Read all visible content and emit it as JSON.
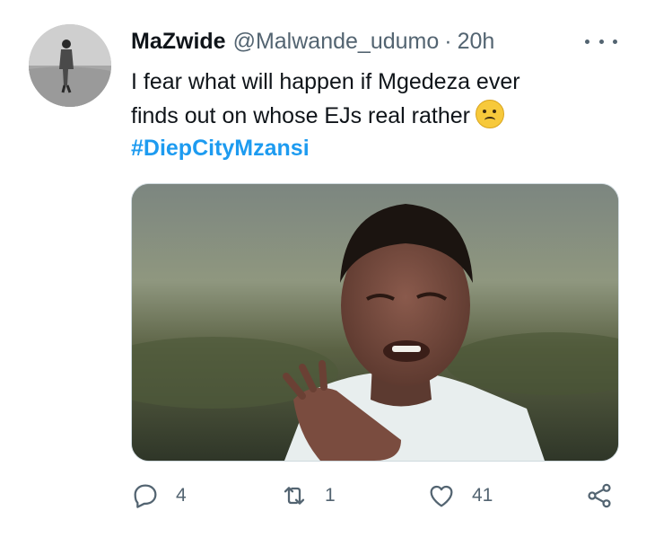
{
  "tweet": {
    "author_name": "MaZwide",
    "author_handle": "@Malwande_udumo",
    "separator": "·",
    "timestamp": "20h",
    "text_line_1": "I fear what will happen if Mgedeza ever",
    "text_line_2": "finds out on whose EJs real rather",
    "hashtag": "#DiepCityMzansi"
  },
  "actions": {
    "reply_count": "4",
    "retweet_count": "1",
    "like_count": "41"
  },
  "icons": {
    "more": "more-horizontal-icon",
    "reply": "reply-icon",
    "retweet": "retweet-icon",
    "like": "heart-icon",
    "share": "share-icon",
    "emoji": "woozy-face-emoji"
  },
  "colors": {
    "text": "#0f1419",
    "secondary": "#536471",
    "link": "#1d9bf0"
  }
}
